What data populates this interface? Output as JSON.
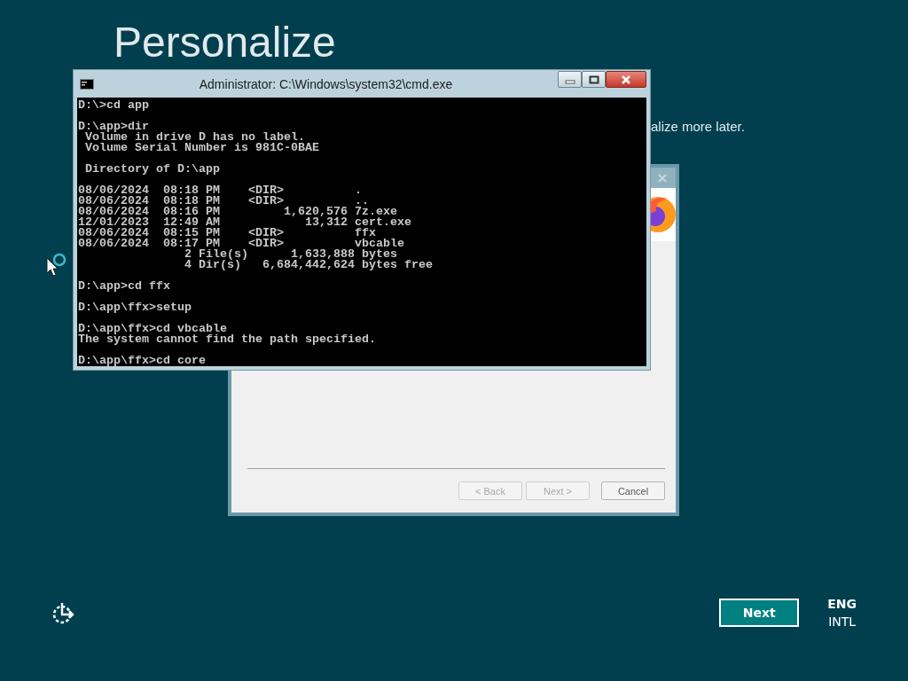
{
  "setup_screen": {
    "title": "Personalize",
    "subtitle": "alize more later."
  },
  "installer_window": {
    "buttons": [
      {
        "label": "< Back",
        "disabled": true
      },
      {
        "label": "Next >",
        "disabled": true
      },
      {
        "label": "Cancel",
        "disabled": false
      }
    ]
  },
  "console_window": {
    "title": "Administrator: C:\\Windows\\system32\\cmd.exe",
    "blocks": [
      [
        "D:\\>cd app"
      ],
      [
        "D:\\app>dir",
        " Volume in drive D has no label.",
        " Volume Serial Number is 981C-0BAE"
      ],
      [
        " Directory of D:\\app"
      ],
      [
        "08/06/2024  08:18 PM    <DIR>          .",
        "08/06/2024  08:18 PM    <DIR>          ..",
        "08/06/2024  08:16 PM         1,620,576 7z.exe",
        "12/01/2023  12:49 AM            13,312 cert.exe",
        "08/06/2024  08:15 PM    <DIR>          ffx",
        "08/06/2024  08:17 PM    <DIR>          vbcable",
        "               2 File(s)      1,633,888 bytes",
        "               4 Dir(s)   6,684,442,624 bytes free"
      ],
      [
        "D:\\app>cd ffx"
      ],
      [
        "D:\\app\\ffx>setup"
      ],
      [
        "D:\\app\\ffx>cd vbcable",
        "The system cannot find the path specified."
      ],
      [
        "D:\\app\\ffx>cd core"
      ]
    ]
  },
  "footer": {
    "next_button": "Next",
    "language": "ENG",
    "layout": "INTL"
  }
}
